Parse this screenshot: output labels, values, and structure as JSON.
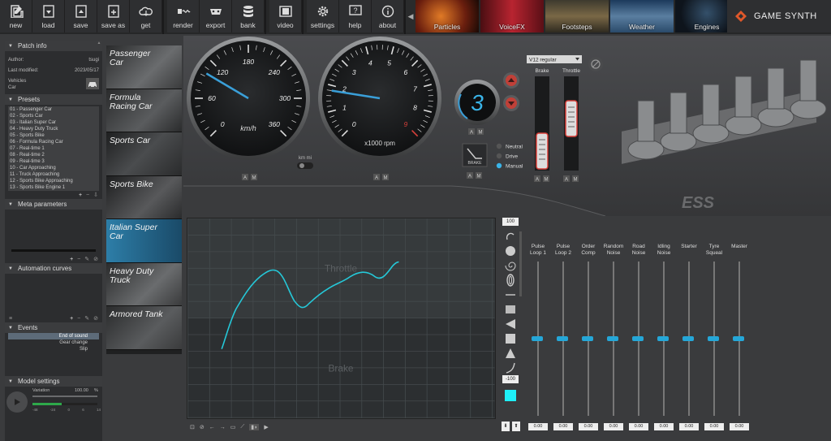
{
  "toolbar": {
    "file": [
      {
        "label": "new",
        "icon": "new-icon"
      },
      {
        "label": "load",
        "icon": "load-icon"
      },
      {
        "label": "save",
        "icon": "save-icon"
      },
      {
        "label": "save as",
        "icon": "save-as-icon"
      },
      {
        "label": "get",
        "icon": "cloud-get-icon"
      }
    ],
    "output": [
      {
        "label": "render",
        "icon": "render-icon"
      },
      {
        "label": "export",
        "icon": "export-icon"
      },
      {
        "label": "bank",
        "icon": "bank-icon"
      }
    ],
    "video": {
      "label": "video",
      "icon": "video-icon"
    },
    "help": [
      {
        "label": "settings",
        "icon": "gear-icon"
      },
      {
        "label": "help",
        "icon": "help-icon"
      },
      {
        "label": "about",
        "icon": "info-icon"
      }
    ],
    "models": [
      {
        "label": "Particles",
        "color": "#7a2a14"
      },
      {
        "label": "VoiceFX",
        "color": "#8e1a22"
      },
      {
        "label": "Footsteps",
        "color": "#5b4a2a"
      },
      {
        "label": "Weather",
        "color": "#2c4a66"
      },
      {
        "label": "Engines",
        "color": "#1e2a3a"
      }
    ],
    "brand": "GAME SYNTH"
  },
  "patch_info": {
    "title": "Patch info",
    "author_label": "Author:",
    "author": "tsugi",
    "modified_label": "Last modified:",
    "modified": "2023/05/17",
    "vehicles_label": "Vehicles",
    "vehicles": "Car"
  },
  "presets": {
    "title": "Presets",
    "items": [
      "01 - Passenger Car",
      "02 - Sports Car",
      "03 - Italian Super Car",
      "04 - Heavy Duty Truck",
      "05 - Sports Bike",
      "06 - Formula Racing Car",
      "07 - Real-time 1",
      "08 - Real-time 2",
      "09 - Real-time 3",
      "10 - Car Approaching",
      "11 - Truck Approaching",
      "12 - Sports Bike Approaching",
      "13 - Sports Bike Engine 1"
    ]
  },
  "meta": {
    "title": "Meta parameters"
  },
  "automation": {
    "title": "Automation curves"
  },
  "events": {
    "title": "Events",
    "items": [
      "End of sound",
      "Gear change",
      "Slip"
    ],
    "selected": 0
  },
  "model_settings": {
    "title": "Model settings",
    "variation_label": "Variation",
    "variation": "100.00",
    "unit": "%",
    "meter": [
      "-48",
      "-24",
      "0",
      "6",
      "14"
    ]
  },
  "cars": [
    {
      "label": "Passenger Car"
    },
    {
      "label": "Formula Racing Car"
    },
    {
      "label": "Sports Car"
    },
    {
      "label": "Sports Bike"
    },
    {
      "label": "Italian Super Car"
    },
    {
      "label": "Heavy Duty Truck"
    },
    {
      "label": "Armored Tank"
    }
  ],
  "cars_selected": 4,
  "speedo": {
    "unit": "km/h",
    "ticks": [
      "0",
      "60",
      "120",
      "180",
      "240",
      "300",
      "360"
    ],
    "value_fraction": 0.28
  },
  "tacho": {
    "unit": "x1000 rpm",
    "ticks": [
      "0",
      "1",
      "2",
      "3",
      "4",
      "5",
      "6",
      "7",
      "8",
      "9"
    ],
    "value_fraction": 0.2
  },
  "units": {
    "label": "km  mi"
  },
  "gear": {
    "value": "3",
    "mode_label": "BRAKE",
    "modes": [
      "Neutral",
      "Drive",
      "Manual"
    ],
    "mode_selected": 2
  },
  "engine_select": {
    "value": "V12 regular"
  },
  "brake_label": "Brake",
  "throttle_label": "Throttle",
  "ess": {
    "logo": "ESS"
  },
  "graph": {
    "throttle_label": "Throttle",
    "brake_label": "Brake"
  },
  "palette": {
    "top": "100",
    "bottom": "-100"
  },
  "mixer": [
    {
      "label": "Pulse Loop 1",
      "value": "0.00",
      "level": 0.5
    },
    {
      "label": "Pulse Loop 2",
      "value": "0.00",
      "level": 0.5
    },
    {
      "label": "Order Comp",
      "value": "0.00",
      "level": 0.5
    },
    {
      "label": "Random Noise",
      "value": "0.00",
      "level": 0.5
    },
    {
      "label": "Road Noise",
      "value": "0.00",
      "level": 0.5
    },
    {
      "label": "Idling Noise",
      "value": "0.00",
      "level": 0.5
    },
    {
      "label": "Starter",
      "value": "0.00",
      "level": 0.5
    },
    {
      "label": "Tyre Squeal",
      "value": "0.00",
      "level": 0.5
    },
    {
      "label": "Master",
      "value": "0.00",
      "level": 0.5
    }
  ],
  "colors": {
    "accent": "#25a7d8",
    "needle": "#3a9fd8",
    "redline": "#d8403a"
  }
}
